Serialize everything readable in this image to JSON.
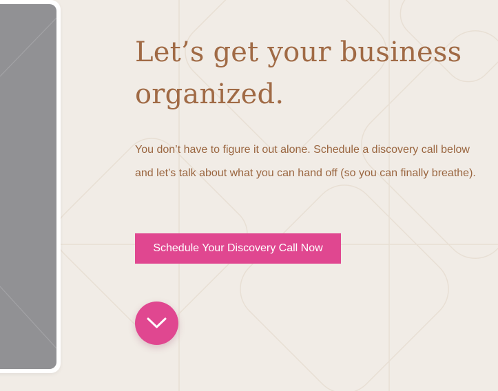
{
  "hero": {
    "heading": "Let’s get your business organized.",
    "description": "You don’t have to figure it out alone. Schedule a discovery call below and let’s talk about what you can hand off (so you can finally breathe).",
    "cta_label": "Schedule Your Discovery Call Now"
  },
  "icons": {
    "scroll_down": "chevron-down-icon"
  },
  "colors": {
    "background": "#f1ece6",
    "heading": "#a06a45",
    "body_text": "#9a6640",
    "accent": "#e04790",
    "image_placeholder": "#919194"
  }
}
